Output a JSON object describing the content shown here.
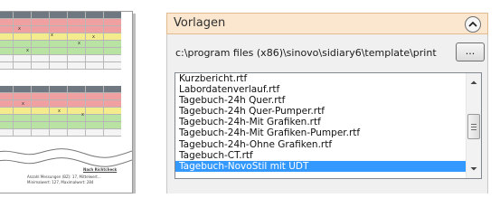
{
  "panel": {
    "title": "Vorlagen",
    "template_path": "c:\\program files (x86)\\sinovo\\sidiary6\\template\\print",
    "browse_label": "..."
  },
  "templates": [
    "Kurzbericht.rtf",
    "Labordatenverlauf.rtf",
    "Tagebuch-24h Quer.rtf",
    "Tagebuch-24h Quer-Pumper.rtf",
    "Tagebuch-24h-Mit Grafiken.rtf",
    "Tagebuch-24h-Mit Grafiken-Pumper.rtf",
    "Tagebuch-24h-Ohne Grafiken.rtf",
    "Tagebuch-CT.rtf",
    "Tagebuch-NovoStil mit UDT"
  ],
  "selected_index": 8,
  "preview": {
    "footer_title": "Nach Richtcheck",
    "footer_line1": "Anzahl Messungen (BZ): 17, Mittelwert...",
    "footer_line2": "Minimalwert: 127, Maximalwert: 284"
  },
  "colors": {
    "selection": "#3399ff",
    "header_bg": "#fbe7cf",
    "header_border": "#e3b98e"
  },
  "icons": {
    "collapse": "chevron-up-circle-icon",
    "scroll_up": "arrow-up-icon",
    "scroll_down": "arrow-down-icon"
  }
}
